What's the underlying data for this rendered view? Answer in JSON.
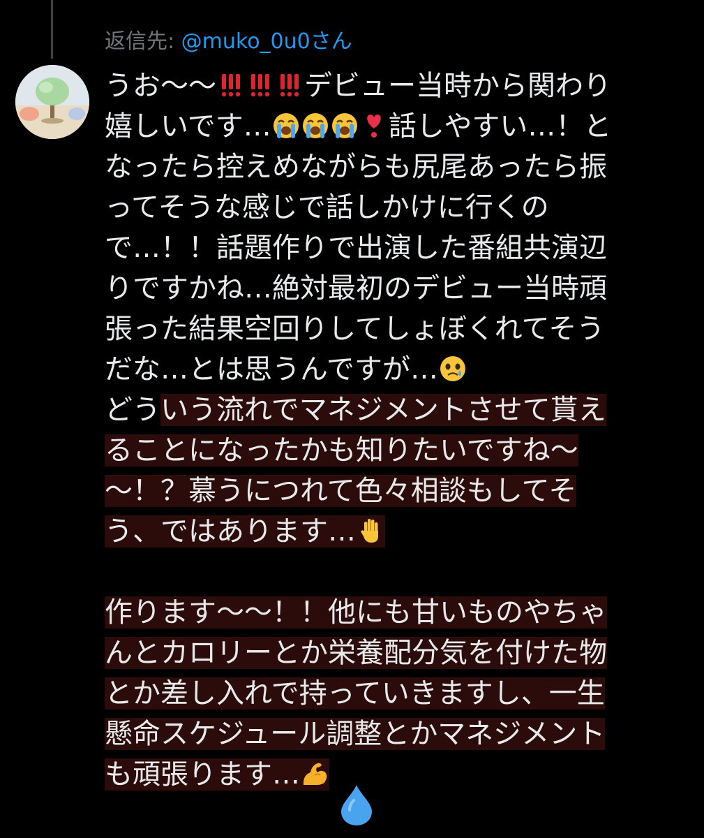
{
  "reply": {
    "prefix": "返信先: ",
    "mention": "@muko_0u0さん"
  },
  "avatar": {
    "icon": "tree-avatar-icon"
  },
  "tweet": {
    "lines": {
      "l1a": "うお〜〜",
      "l1b": "デビュー当時から関わり",
      "l2a": "嬉しいです…",
      "l2b": "話しやすい…！と",
      "l3": "なったら控えめながらも尻尾あったら振",
      "l4": "ってそうな感じで話しかけに行くの",
      "l5": "で…！！話題作りで出演した番組共演辺",
      "l6": "りですかね…絶対最初のデビュー当時頑",
      "l7": "張った結果空回りしてしょぼくれてそう",
      "l8": "だな…とは思うんですが…",
      "l9a": "どう",
      "l9b": "いう流れでマネジメントさせて貰え",
      "l10": "ることになったかも知りたいですね〜",
      "l11": "〜！？慕うにつれて色々相談もしてそ",
      "l12": "う、ではあります…",
      "l13": "作ります〜〜！！他にも甘いものやちゃ",
      "l14": "んとカロリーとか栄養配分気を付けた物",
      "l15": "とか差し入れで持っていきますし、一生",
      "l16": "懸命スケジュール調整とかマネジメント",
      "l17": "も頑張ります…"
    },
    "emojis": {
      "double_exclamation": "double-exclamation-icon",
      "crying": "loudly-crying-face-icon",
      "heart_exclamation": "heart-exclamation-icon",
      "holding_back_tears": "face-holding-back-tears-icon",
      "raised_hand": "raised-hand-icon",
      "flexed_biceps": "flexed-biceps-icon"
    }
  },
  "bottom_icon": "water-drop-icon",
  "colors": {
    "background": "#000000",
    "text": "#e7e9ea",
    "muted": "#71767b",
    "link": "#1d9bf0",
    "highlight": "#2b0c0b"
  }
}
